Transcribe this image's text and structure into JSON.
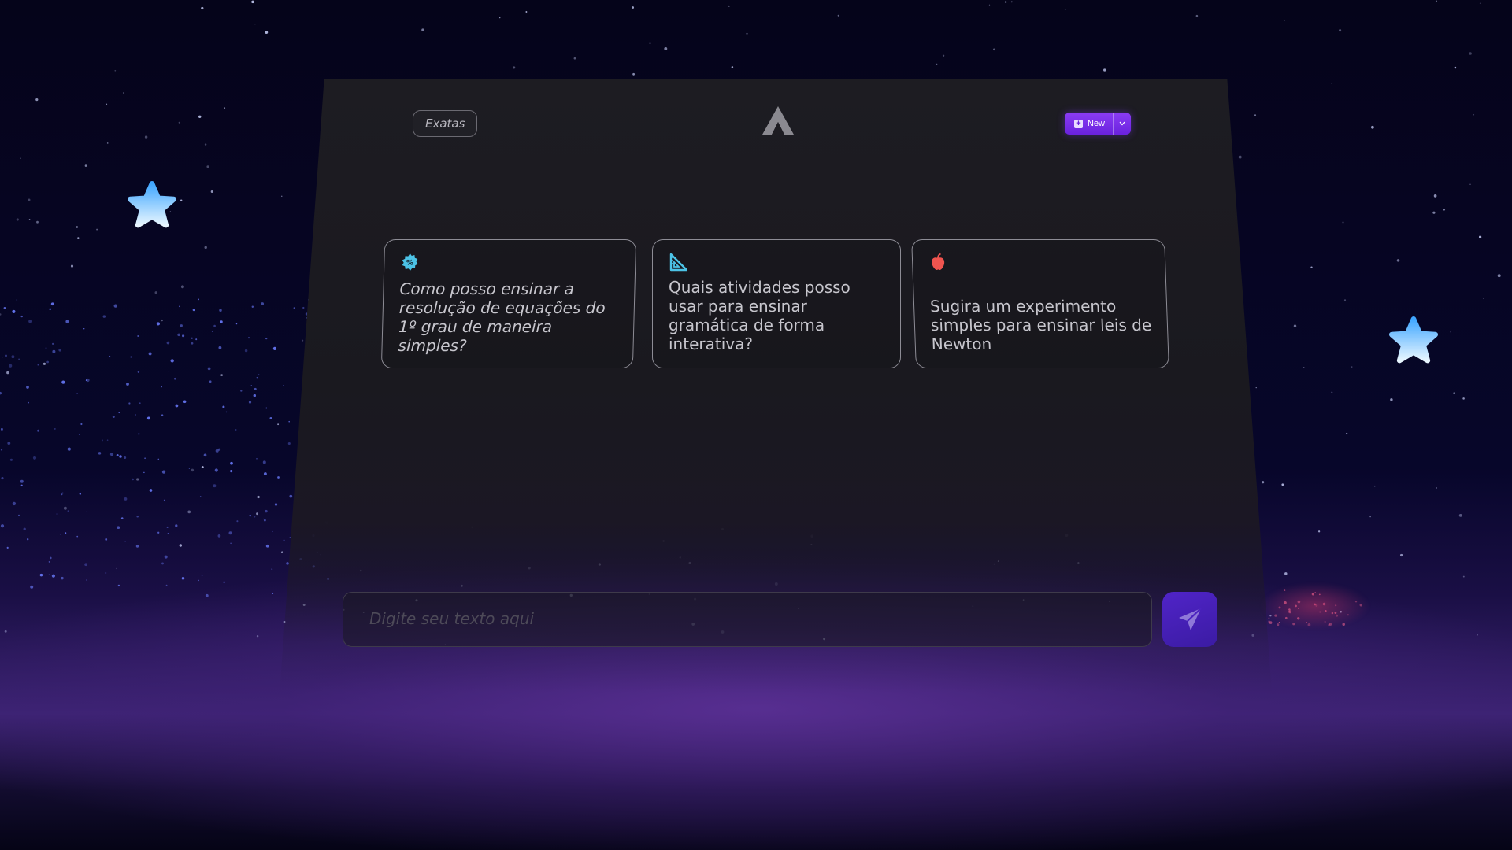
{
  "background": {
    "accent_glow": "#4b2a87",
    "deco_star_color": "#6fc4ff"
  },
  "header": {
    "category_label": "Exatas",
    "logo_icon": "triangle-a-logo-icon",
    "new_button_label": "New",
    "new_button_color": "#7a2ff0"
  },
  "suggestions": [
    {
      "icon": "percent-gear-icon",
      "icon_color": "#4cc3e6",
      "text": "Como posso ensinar a resolução de equações do 1º grau de maneira simples?"
    },
    {
      "icon": "set-square-ruler-icon",
      "icon_color": "#4cc3e6",
      "text": "Quais atividades posso usar para ensinar gramática de forma interativa?"
    },
    {
      "icon": "apple-icon",
      "icon_color": "#f0544f",
      "text": "Sugira um experimento simples para ensinar leis de Newton"
    }
  ],
  "composer": {
    "placeholder": "Digite seu texto aqui",
    "send_icon": "paper-plane-icon",
    "send_color": "#4a22bf"
  }
}
